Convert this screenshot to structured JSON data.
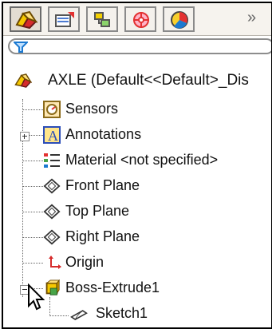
{
  "toolbar": {
    "tabs": [
      {
        "icon": "featuremanager-icon"
      },
      {
        "icon": "propertymanager-icon"
      },
      {
        "icon": "configurationmanager-icon"
      },
      {
        "icon": "dimxpert-icon"
      },
      {
        "icon": "display-manager-icon"
      }
    ],
    "more_label": "»"
  },
  "filter": {
    "icon": "filter-icon"
  },
  "tree": {
    "root": {
      "label": "AXLE  (Default<<Default>_Dis",
      "icon": "part-icon"
    },
    "items": [
      {
        "label": "Sensors",
        "icon": "sensors-icon"
      },
      {
        "label": "Annotations",
        "icon": "annotations-icon"
      },
      {
        "label": "Material <not specified>",
        "icon": "material-icon"
      },
      {
        "label": "Front Plane",
        "icon": "plane-icon"
      },
      {
        "label": "Top Plane",
        "icon": "plane-icon"
      },
      {
        "label": "Right Plane",
        "icon": "plane-icon"
      },
      {
        "label": "Origin",
        "icon": "origin-icon"
      },
      {
        "label": "Boss-Extrude1",
        "icon": "extrude-icon"
      },
      {
        "label": "Sketch1",
        "icon": "sketch-icon"
      }
    ]
  },
  "colors": {
    "border": "#000000",
    "toolbar_bg": "#f6f3ee",
    "filter_blue": "#1b79d1",
    "accent_yellow": "#f0c300",
    "accent_green": "#47a447",
    "accent_red": "#e33131"
  }
}
